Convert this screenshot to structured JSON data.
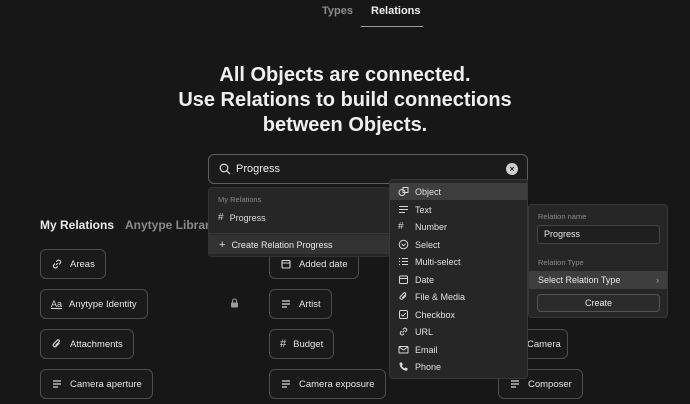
{
  "tabs": {
    "types": "Types",
    "relations": "Relations"
  },
  "hero": {
    "line1": "All Objects are connected.",
    "line2": "Use Relations to build connections",
    "line3": "between Objects."
  },
  "search": {
    "value": "Progress",
    "clear_icon": "clear-icon"
  },
  "sections": {
    "mine": "My Relations",
    "library": "Anytype Library"
  },
  "relations": {
    "areas": "Areas",
    "anytype_identity": "Anytype Identity",
    "attachments": "Attachments",
    "camera_aperture": "Camera aperture",
    "added_date": "Added date",
    "artist": "Artist",
    "budget": "Budget",
    "camera_exposure": "Camera exposure",
    "camera": "Camera",
    "composer": "Composer"
  },
  "search_popup": {
    "header": "My Relations",
    "result": "Progress",
    "create": "Create Relation Progress"
  },
  "relation_types": [
    {
      "label": "Object",
      "icon": "object-icon"
    },
    {
      "label": "Text",
      "icon": "text-icon"
    },
    {
      "label": "Number",
      "icon": "number-icon"
    },
    {
      "label": "Select",
      "icon": "select-icon"
    },
    {
      "label": "Multi-select",
      "icon": "multi-select-icon"
    },
    {
      "label": "Date",
      "icon": "date-icon"
    },
    {
      "label": "File & Media",
      "icon": "file-icon"
    },
    {
      "label": "Checkbox",
      "icon": "checkbox-icon"
    },
    {
      "label": "URL",
      "icon": "url-icon"
    },
    {
      "label": "Email",
      "icon": "email-icon"
    },
    {
      "label": "Phone",
      "icon": "phone-icon"
    }
  ],
  "new_relation": {
    "name_label": "Relation name",
    "name_value": "Progress",
    "type_label": "Relation Type",
    "type_select": "Select Relation Type",
    "create": "Create"
  },
  "colors": {
    "background": "#171717",
    "popup": "#262626",
    "highlight": "#3e3e3e"
  }
}
